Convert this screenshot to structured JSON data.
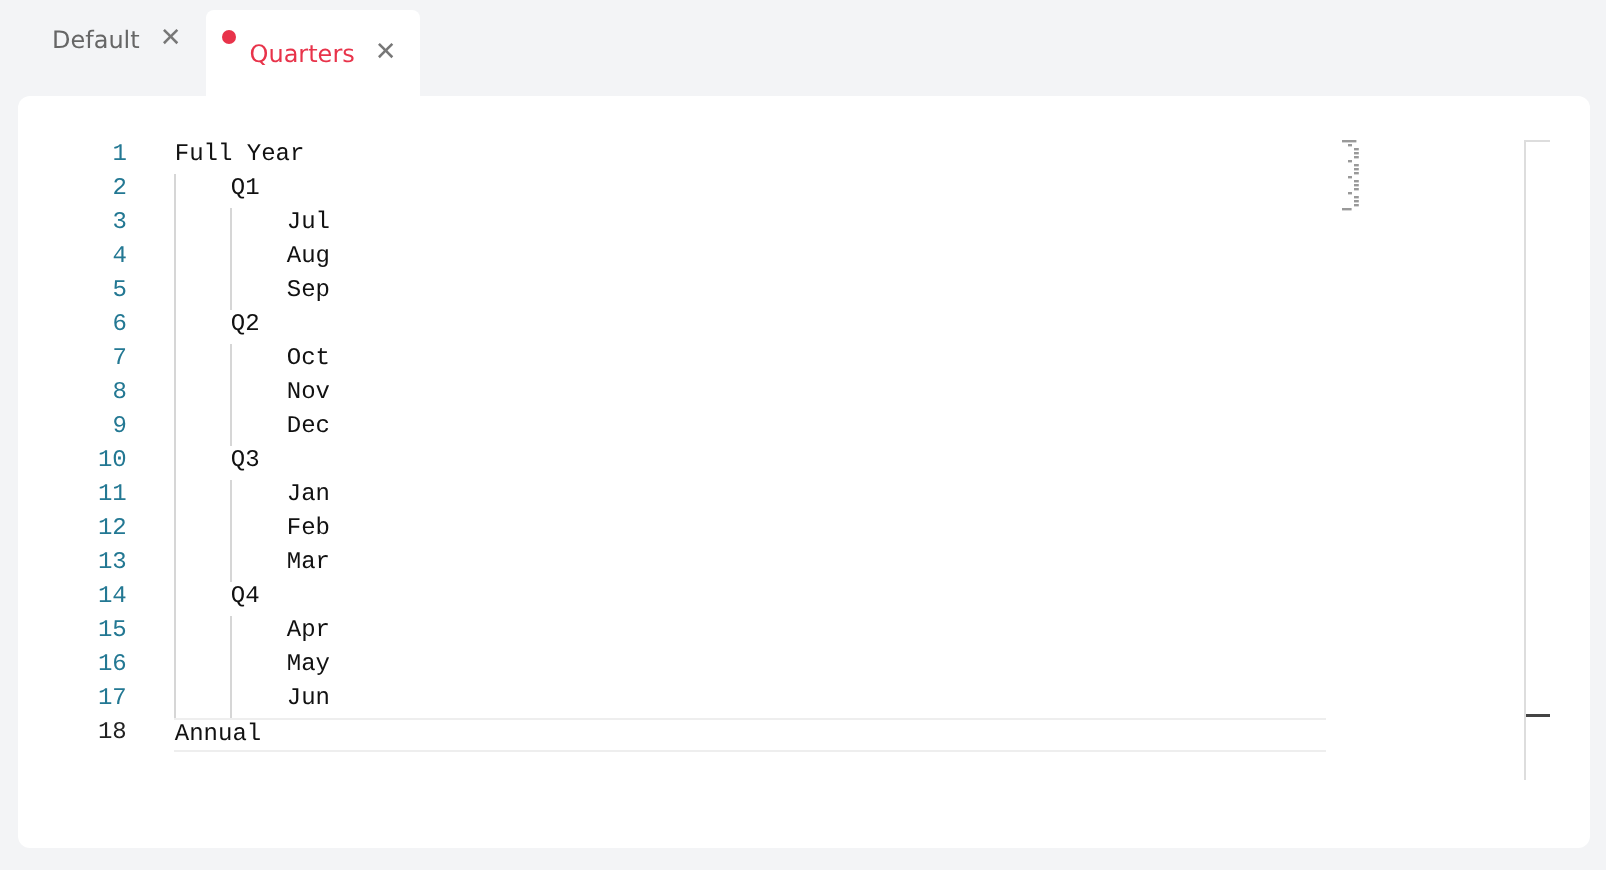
{
  "tabs": [
    {
      "label": "Default",
      "selected": false,
      "modified": false,
      "close": "✕"
    },
    {
      "label": "Quarters",
      "selected": true,
      "modified": true,
      "close": "✕"
    }
  ],
  "editor": {
    "lines": [
      {
        "number": "1",
        "text": "Full Year",
        "current": false,
        "children": [
          {
            "number": "2",
            "text": "Q1",
            "current": false,
            "children": [
              {
                "number": "3",
                "text": "Jul",
                "current": false
              },
              {
                "number": "4",
                "text": "Aug",
                "current": false
              },
              {
                "number": "5",
                "text": "Sep",
                "current": false
              }
            ]
          },
          {
            "number": "6",
            "text": "Q2",
            "current": false,
            "children": [
              {
                "number": "7",
                "text": "Oct",
                "current": false
              },
              {
                "number": "8",
                "text": "Nov",
                "current": false
              },
              {
                "number": "9",
                "text": "Dec",
                "current": false
              }
            ]
          },
          {
            "number": "10",
            "text": "Q3",
            "current": false,
            "children": [
              {
                "number": "11",
                "text": "Jan",
                "current": false
              },
              {
                "number": "12",
                "text": "Feb",
                "current": false
              },
              {
                "number": "13",
                "text": "Mar",
                "current": false
              }
            ]
          },
          {
            "number": "14",
            "text": "Q4",
            "current": false,
            "children": [
              {
                "number": "15",
                "text": "Apr",
                "current": false
              },
              {
                "number": "16",
                "text": "May",
                "current": false
              },
              {
                "number": "17",
                "text": "Jun",
                "current": false
              }
            ]
          }
        ]
      },
      {
        "number": "18",
        "text": "Annual",
        "current": true
      }
    ]
  }
}
